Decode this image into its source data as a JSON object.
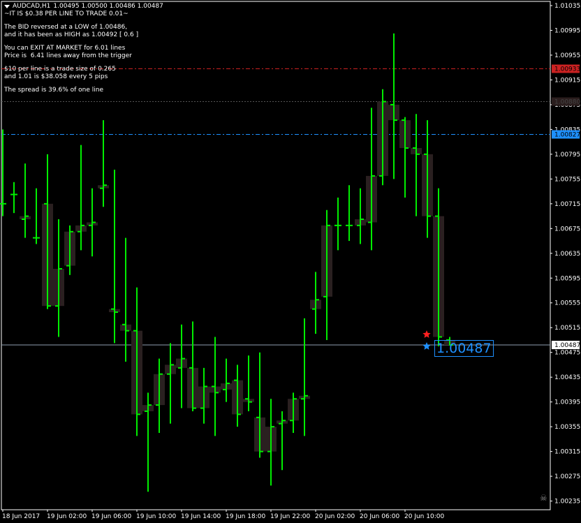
{
  "header": {
    "symbol": "AUDCAD,H1",
    "ohlc": "1.00495 1.00500 1.00486 1.00487"
  },
  "info_lines": [
    "~IT IS $0.38 PER LINE TO TRADE 0.01~",
    "",
    "The BID reversed at a LOW of 1.00486,",
    "and it has been as HIGH as 1.00492 [ 0.6 ]",
    "",
    "You can EXIT AT MARKET for 6.01 lines",
    "Price is  6.41 lines away from the trigger",
    "",
    "$10 per line is a trade size of 0.265",
    "and 1.01 is $38.058 every 5 pips",
    "",
    "The spread is 39.6% of one line"
  ],
  "price_box": "1.00487",
  "colors": {
    "background": "#000000",
    "bars": "#00ee00",
    "candle_body": "#2a2020",
    "axis_text": "#ffffff",
    "red_line": "#cc2222",
    "blue_line": "#1e90ff",
    "bid_line": "#8fa0b0",
    "gray_line": "#555555"
  },
  "chart_data": {
    "type": "ohlc",
    "ylim": [
      1.0023,
      1.01035
    ],
    "y_ticks": [
      "1.01035",
      "1.00995",
      "1.00955",
      "1.00915",
      "1.00875",
      "1.00835",
      "1.00795",
      "1.00755",
      "1.00715",
      "1.00675",
      "1.00635",
      "1.00595",
      "1.00555",
      "1.00515",
      "1.00475",
      "1.00435",
      "1.00395",
      "1.00355",
      "1.00315",
      "1.00275",
      "1.00235"
    ],
    "x_ticks": [
      {
        "label": "18 Jun 2017",
        "bar": 0
      },
      {
        "label": "19 Jun 02:00",
        "bar": 4
      },
      {
        "label": "19 Jun 06:00",
        "bar": 8
      },
      {
        "label": "19 Jun 10:00",
        "bar": 12
      },
      {
        "label": "19 Jun 14:00",
        "bar": 16
      },
      {
        "label": "19 Jun 18:00",
        "bar": 20
      },
      {
        "label": "19 Jun 22:00",
        "bar": 24
      },
      {
        "label": "20 Jun 02:00",
        "bar": 28
      },
      {
        "label": "20 Jun 06:00",
        "bar": 32
      },
      {
        "label": "20 Jun 10:00",
        "bar": 36
      }
    ],
    "bars": [
      {
        "o": 1.00715,
        "h": 1.00835,
        "l": 1.00695,
        "c": 1.00715
      },
      {
        "o": 1.0073,
        "h": 1.0075,
        "l": 1.007,
        "c": 1.0073
      },
      {
        "o": 1.0069,
        "h": 1.0078,
        "l": 1.0066,
        "c": 1.00695
      },
      {
        "o": 1.0066,
        "h": 1.0074,
        "l": 1.0065,
        "c": 1.0066
      },
      {
        "o": 1.00715,
        "h": 1.00795,
        "l": 1.00545,
        "c": 1.0055
      },
      {
        "o": 1.0055,
        "h": 1.0069,
        "l": 1.005,
        "c": 1.0061
      },
      {
        "o": 1.00615,
        "h": 1.0068,
        "l": 1.006,
        "c": 1.0067
      },
      {
        "o": 1.0067,
        "h": 1.0081,
        "l": 1.0064,
        "c": 1.0068
      },
      {
        "o": 1.0068,
        "h": 1.0074,
        "l": 1.0063,
        "c": 1.00685
      },
      {
        "o": 1.0074,
        "h": 1.0085,
        "l": 1.0071,
        "c": 1.00745
      },
      {
        "o": 1.00545,
        "h": 1.0077,
        "l": 1.0049,
        "c": 1.0054
      },
      {
        "o": 1.0052,
        "h": 1.0066,
        "l": 1.0046,
        "c": 1.0051
      },
      {
        "o": 1.0051,
        "h": 1.0058,
        "l": 1.0034,
        "c": 1.00375
      },
      {
        "o": 1.0038,
        "h": 1.0041,
        "l": 1.0025,
        "c": 1.0039
      },
      {
        "o": 1.0039,
        "h": 1.00465,
        "l": 1.00345,
        "c": 1.0044
      },
      {
        "o": 1.0044,
        "h": 1.0049,
        "l": 1.0036,
        "c": 1.00455
      },
      {
        "o": 1.0045,
        "h": 1.0052,
        "l": 1.00385,
        "c": 1.00465
      },
      {
        "o": 1.0045,
        "h": 1.00525,
        "l": 1.0038,
        "c": 1.00385
      },
      {
        "o": 1.00385,
        "h": 1.0045,
        "l": 1.0036,
        "c": 1.0042
      },
      {
        "o": 1.0042,
        "h": 1.005,
        "l": 1.0034,
        "c": 1.0041
      },
      {
        "o": 1.00415,
        "h": 1.00465,
        "l": 1.00395,
        "c": 1.00425
      },
      {
        "o": 1.0043,
        "h": 1.00455,
        "l": 1.00355,
        "c": 1.00375
      },
      {
        "o": 1.004,
        "h": 1.0047,
        "l": 1.0038,
        "c": 1.00395
      },
      {
        "o": 1.0037,
        "h": 1.00475,
        "l": 1.00305,
        "c": 1.00315
      },
      {
        "o": 1.00315,
        "h": 1.004,
        "l": 1.0026,
        "c": 1.00355
      },
      {
        "o": 1.0036,
        "h": 1.0038,
        "l": 1.00285,
        "c": 1.00365
      },
      {
        "o": 1.00365,
        "h": 1.0041,
        "l": 1.00345,
        "c": 1.004
      },
      {
        "o": 1.004,
        "h": 1.0053,
        "l": 1.0034,
        "c": 1.00405
      },
      {
        "o": 1.00545,
        "h": 1.00605,
        "l": 1.00505,
        "c": 1.0056
      },
      {
        "o": 1.00565,
        "h": 1.00705,
        "l": 1.00495,
        "c": 1.0068
      },
      {
        "o": 1.0068,
        "h": 1.00725,
        "l": 1.0064,
        "c": 1.0068
      },
      {
        "o": 1.0068,
        "h": 1.00745,
        "l": 1.00655,
        "c": 1.0068
      },
      {
        "o": 1.0068,
        "h": 1.0074,
        "l": 1.0065,
        "c": 1.0069
      },
      {
        "o": 1.00685,
        "h": 1.0087,
        "l": 1.0064,
        "c": 1.0076
      },
      {
        "o": 1.0076,
        "h": 1.009,
        "l": 1.00745,
        "c": 1.0088
      },
      {
        "o": 1.00875,
        "h": 1.0099,
        "l": 1.00755,
        "c": 1.0085
      },
      {
        "o": 1.0085,
        "h": 1.00855,
        "l": 1.00725,
        "c": 1.00805
      },
      {
        "o": 1.00805,
        "h": 1.0086,
        "l": 1.00695,
        "c": 1.00795
      },
      {
        "o": 1.00795,
        "h": 1.0085,
        "l": 1.0066,
        "c": 1.00695
      },
      {
        "o": 1.00695,
        "h": 1.0074,
        "l": 1.00485,
        "c": 1.005
      },
      {
        "o": 1.00495,
        "h": 1.005,
        "l": 1.00486,
        "c": 1.00487
      }
    ],
    "levels": {
      "red": {
        "price": 1.00933,
        "label": "1.00933"
      },
      "gray": {
        "price": 1.0088,
        "label": "1.00880"
      },
      "blue": {
        "price": 1.00827,
        "label": "1.00827"
      },
      "bid": {
        "price": 1.00487,
        "label": "1.00487"
      }
    }
  }
}
